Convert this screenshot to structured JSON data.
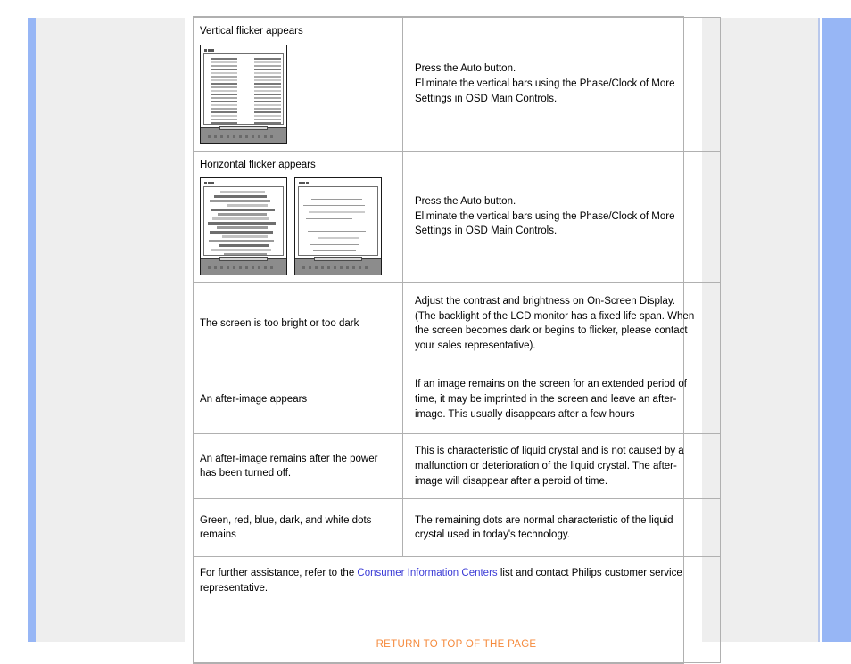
{
  "page": {
    "background": "#ffffff",
    "rail_color": "#97b6f5",
    "panel_color": "#eeeeee"
  },
  "table": {
    "rows": [
      {
        "id": "vertical-flicker",
        "symptom": "Vertical flicker appears",
        "has_image": true,
        "image_kind": "vertical-flicker-monitor",
        "image_count": 1,
        "solution_lines": [
          "Press the Auto button.",
          "Eliminate the vertical bars using the Phase/Clock of More",
          "Settings in OSD Main Controls."
        ]
      },
      {
        "id": "horizontal-flicker",
        "symptom": "Horizontal flicker appears",
        "has_image": true,
        "image_kind": "horizontal-flicker-monitor-pair",
        "image_count": 2,
        "solution_lines": [
          "Press the Auto button.",
          "Eliminate the vertical bars using the Phase/Clock of More",
          "Settings in OSD Main Controls."
        ]
      },
      {
        "id": "brightness",
        "symptom": "The screen is too bright or too dark",
        "has_image": false,
        "solution_lines": [
          "Adjust the contrast and brightness on On-Screen Display.",
          "(The backlight of the LCD monitor has a fixed life span. When",
          "the screen becomes dark or begins to flicker, please contact",
          "your sales representative)."
        ]
      },
      {
        "id": "after-image-appears",
        "symptom": "An after-image appears",
        "has_image": false,
        "solution_lines": [
          "If an image remains on the screen for an extended period of",
          "time, it may be imprinted in the screen and leave an after-",
          "image. This usually disappears after a few hours"
        ]
      },
      {
        "id": "after-image-power-off",
        "symptom": "An after-image remains after the power has been turned off.",
        "has_image": false,
        "solution_lines": [
          "This is characteristic of liquid crystal and is not caused by a",
          "malfunction or deterioration of the liquid crystal. The after-",
          "image will disappear after a peroid of time."
        ]
      },
      {
        "id": "colored-dots",
        "symptom": "Green, red, blue, dark, and white dots remains",
        "has_image": false,
        "solution_lines": [
          "The remaining dots are normal characteristic of the liquid",
          "crystal used in today's technology."
        ]
      }
    ]
  },
  "footer": {
    "text_before_link": "For further assistance, refer to the ",
    "link_label": "Consumer Information Centers",
    "link_color": "#3b3bd6",
    "text_after_link": " list and contact Philips customer service representative.",
    "return_to_top_label": "RETURN TO TOP OF THE PAGE",
    "return_to_top_color": "#f58a3c"
  }
}
